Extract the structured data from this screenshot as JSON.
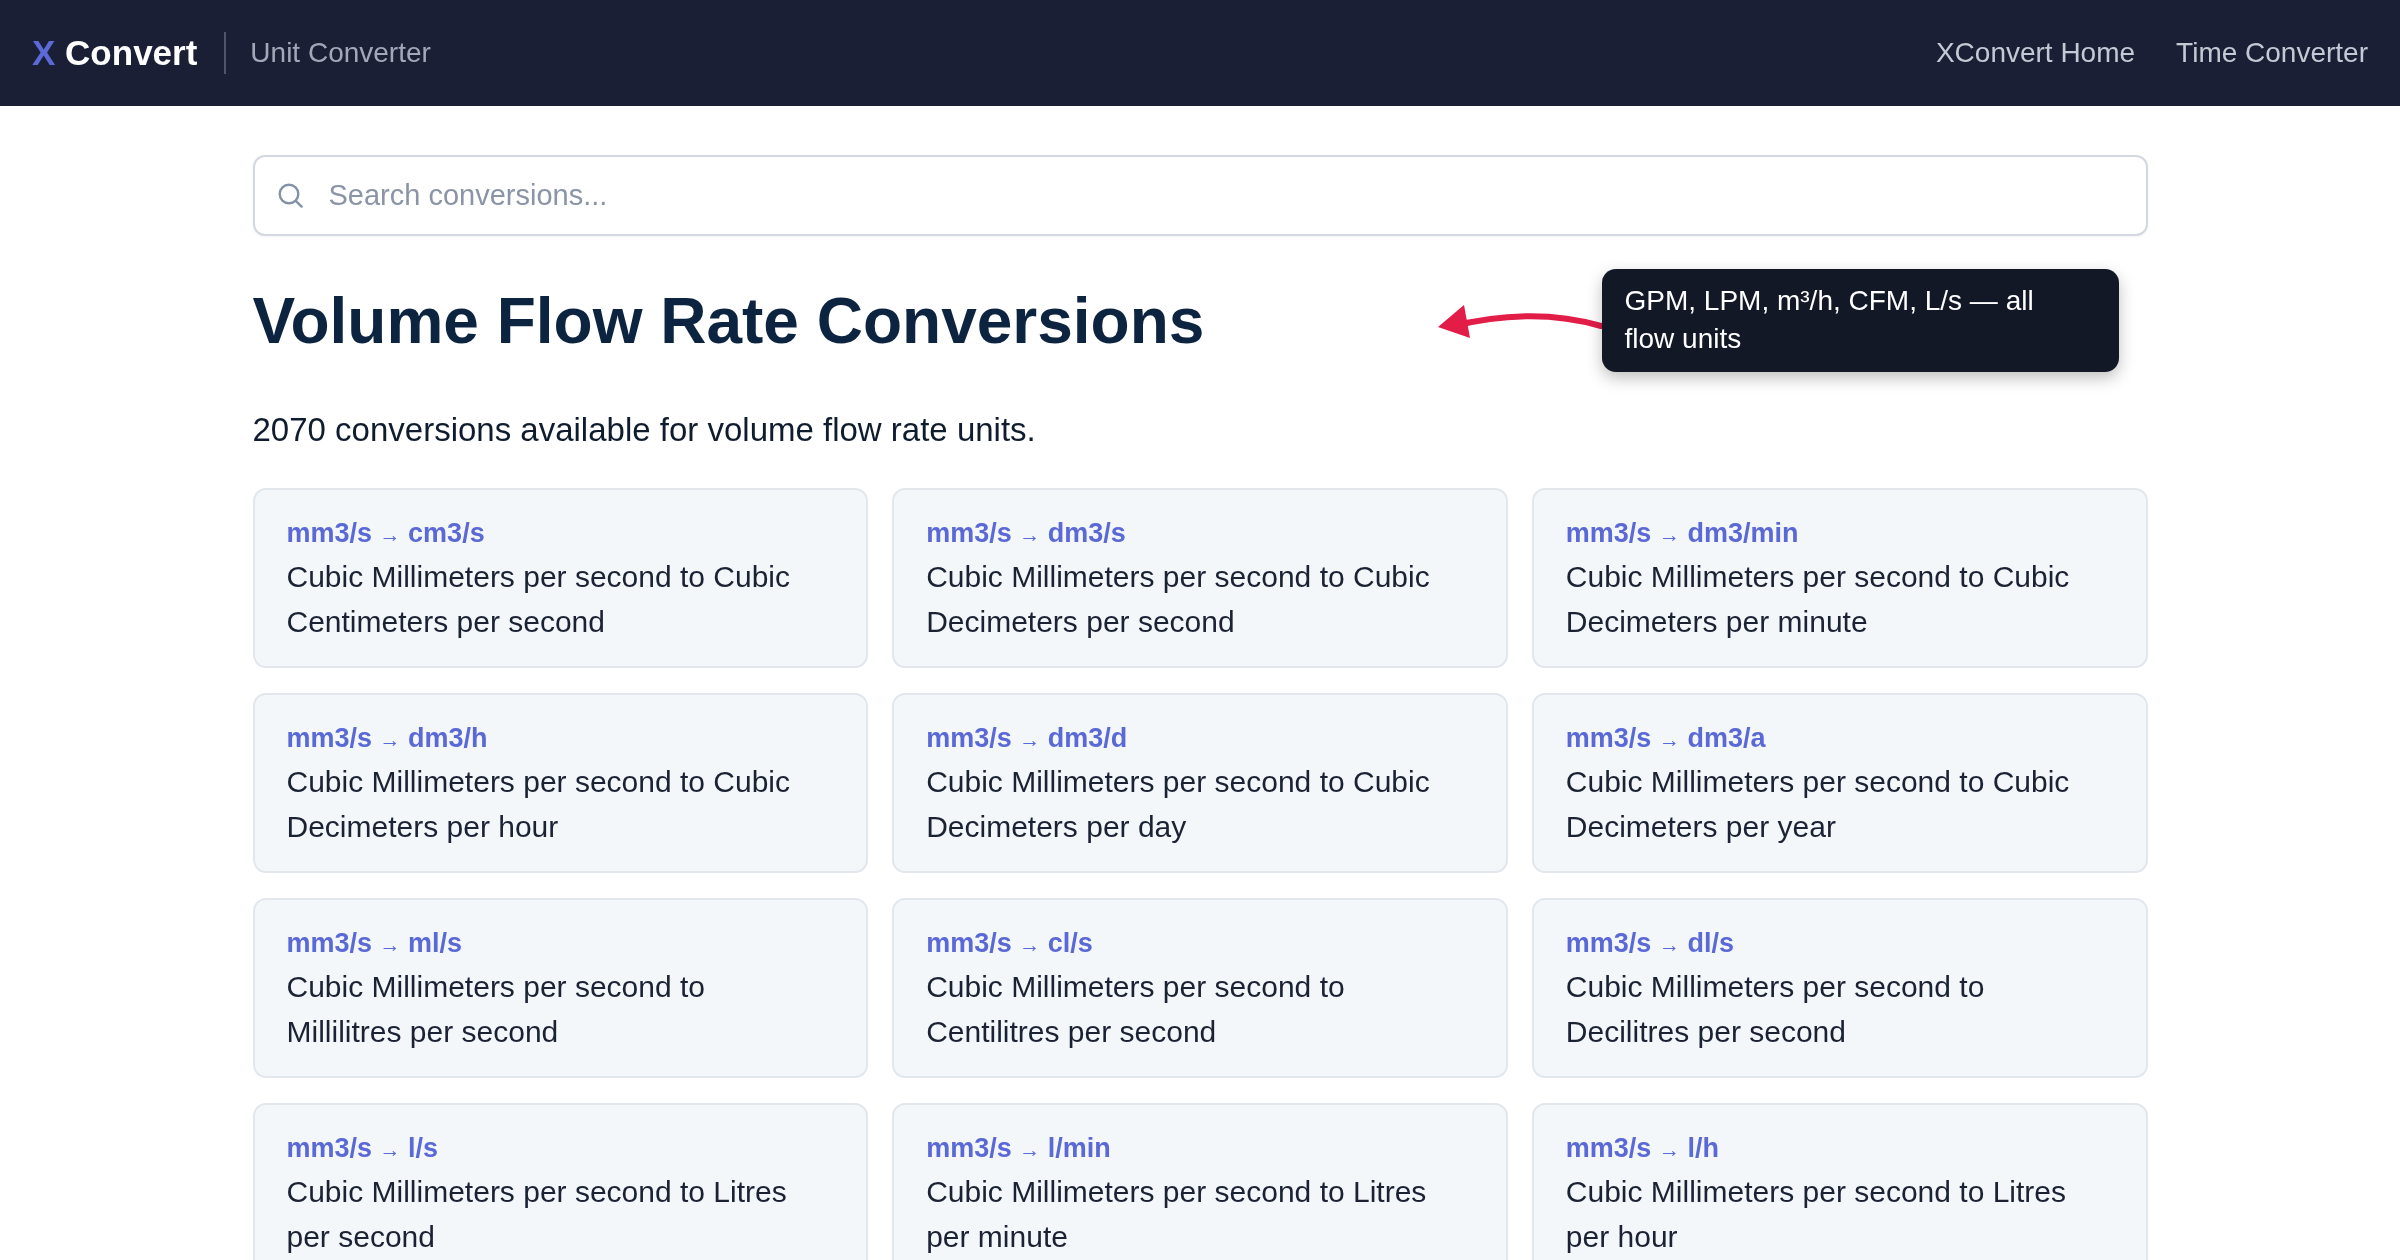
{
  "header": {
    "logo": {
      "mark": "X",
      "name": "Convert"
    },
    "section": "Unit Converter",
    "nav": [
      {
        "label": "XConvert Home"
      },
      {
        "label": "Time Converter"
      }
    ]
  },
  "search": {
    "placeholder": "Search conversions..."
  },
  "title": "Volume Flow Rate Conversions",
  "callout": {
    "text": "GPM, LPM, m³/h, CFM, L/s — all flow units"
  },
  "summary": "2070 conversions available for volume flow rate units.",
  "conversions": [
    {
      "from": "mm3/s",
      "arrow": "→",
      "to": "cm3/s",
      "description": "Cubic Millimeters per second to Cubic Centimeters per second"
    },
    {
      "from": "mm3/s",
      "arrow": "→",
      "to": "dm3/s",
      "description": "Cubic Millimeters per second to Cubic Decimeters per second"
    },
    {
      "from": "mm3/s",
      "arrow": "→",
      "to": "dm3/min",
      "description": "Cubic Millimeters per second to Cubic Decimeters per minute"
    },
    {
      "from": "mm3/s",
      "arrow": "→",
      "to": "dm3/h",
      "description": "Cubic Millimeters per second to Cubic Decimeters per hour"
    },
    {
      "from": "mm3/s",
      "arrow": "→",
      "to": "dm3/d",
      "description": "Cubic Millimeters per second to Cubic Decimeters per day"
    },
    {
      "from": "mm3/s",
      "arrow": "→",
      "to": "dm3/a",
      "description": "Cubic Millimeters per second to Cubic Decimeters per year"
    },
    {
      "from": "mm3/s",
      "arrow": "→",
      "to": "ml/s",
      "description": "Cubic Millimeters per second to Millilitres per second"
    },
    {
      "from": "mm3/s",
      "arrow": "→",
      "to": "cl/s",
      "description": "Cubic Millimeters per second to Centilitres per second"
    },
    {
      "from": "mm3/s",
      "arrow": "→",
      "to": "dl/s",
      "description": "Cubic Millimeters per second to Decilitres per second"
    },
    {
      "from": "mm3/s",
      "arrow": "→",
      "to": "l/s",
      "description": "Cubic Millimeters per second to Litres per second"
    },
    {
      "from": "mm3/s",
      "arrow": "→",
      "to": "l/min",
      "description": "Cubic Millimeters per second to Litres per minute"
    },
    {
      "from": "mm3/s",
      "arrow": "→",
      "to": "l/h",
      "description": "Cubic Millimeters per second to Litres per hour"
    }
  ]
}
